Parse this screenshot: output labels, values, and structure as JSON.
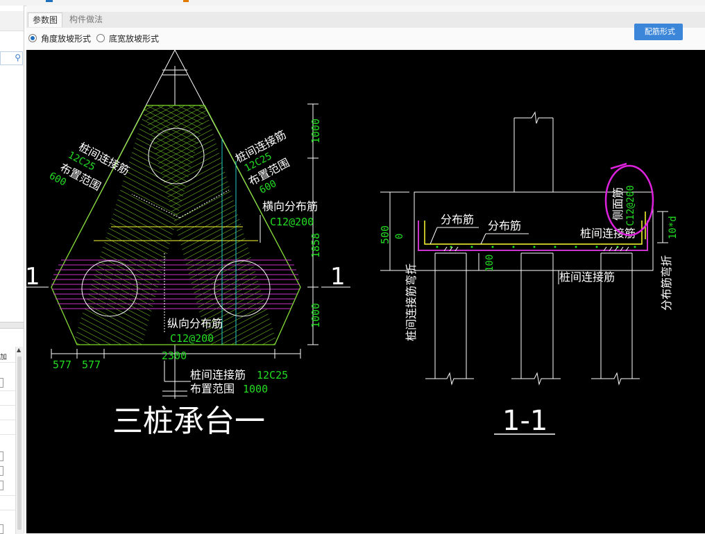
{
  "tabs": [
    {
      "label": "参数图",
      "active": true
    },
    {
      "label": "构件做法",
      "active": false
    }
  ],
  "slope_options": [
    {
      "label": "角度放坡形式",
      "selected": true
    },
    {
      "label": "底宽放坡形式",
      "selected": false
    }
  ],
  "rebar_button": "配筋形式",
  "left_panel": {
    "search_icon": "search-icon",
    "partial_label": "加"
  },
  "drawing": {
    "plan": {
      "title": "三桩承台一",
      "section_mark": "1",
      "left_conn_label": "桩间连接筋",
      "left_conn_value": "12C25",
      "left_range_label": "布置范围",
      "left_range_value": "600",
      "right_conn_label": "桩间连接筋",
      "right_conn_value": "12C25",
      "right_range_label": "布置范围",
      "right_range_value": "600",
      "transverse_label": "横向分布筋",
      "transverse_value": "C12@200",
      "longitudinal_label": "纵向分布筋",
      "longitudinal_value": "C12@200",
      "dim_top": "1000",
      "dim_mid": "1858",
      "dim_bottom": "1000",
      "dim_a": "577",
      "dim_b": "577",
      "dim_width": "2300",
      "bottom_conn_label": "桩间连接筋",
      "bottom_conn_value": "12C25",
      "bottom_range_label": "布置范围",
      "bottom_range_value": "1000"
    },
    "section": {
      "title": "1-1",
      "dim_height": "500",
      "dim_zero": "0",
      "dist_label_1": "分布筋",
      "dist_label_2": "分布筋",
      "conn_label_top": "桩间连接筋",
      "conn_label_bottom": "桩间连接筋",
      "side_label": "侧面筋",
      "side_value": "C12@200",
      "ten_d": "10*d",
      "bend_left": "桩间连接筋弯折",
      "bend_right": "分布筋弯折",
      "pile_cover": "100"
    }
  },
  "colors": {
    "canvas": "#000000",
    "cad_white": "#ffffff",
    "cad_green": "#22dd22",
    "rebar_green": "#7ddc2a",
    "rebar_magenta": "#cc33cc",
    "rebar_yellow": "#ffff33",
    "rebar_cyan": "#22cccc",
    "annotation_magenta": "#dd22dd",
    "accent_blue": "#3b86d8"
  }
}
